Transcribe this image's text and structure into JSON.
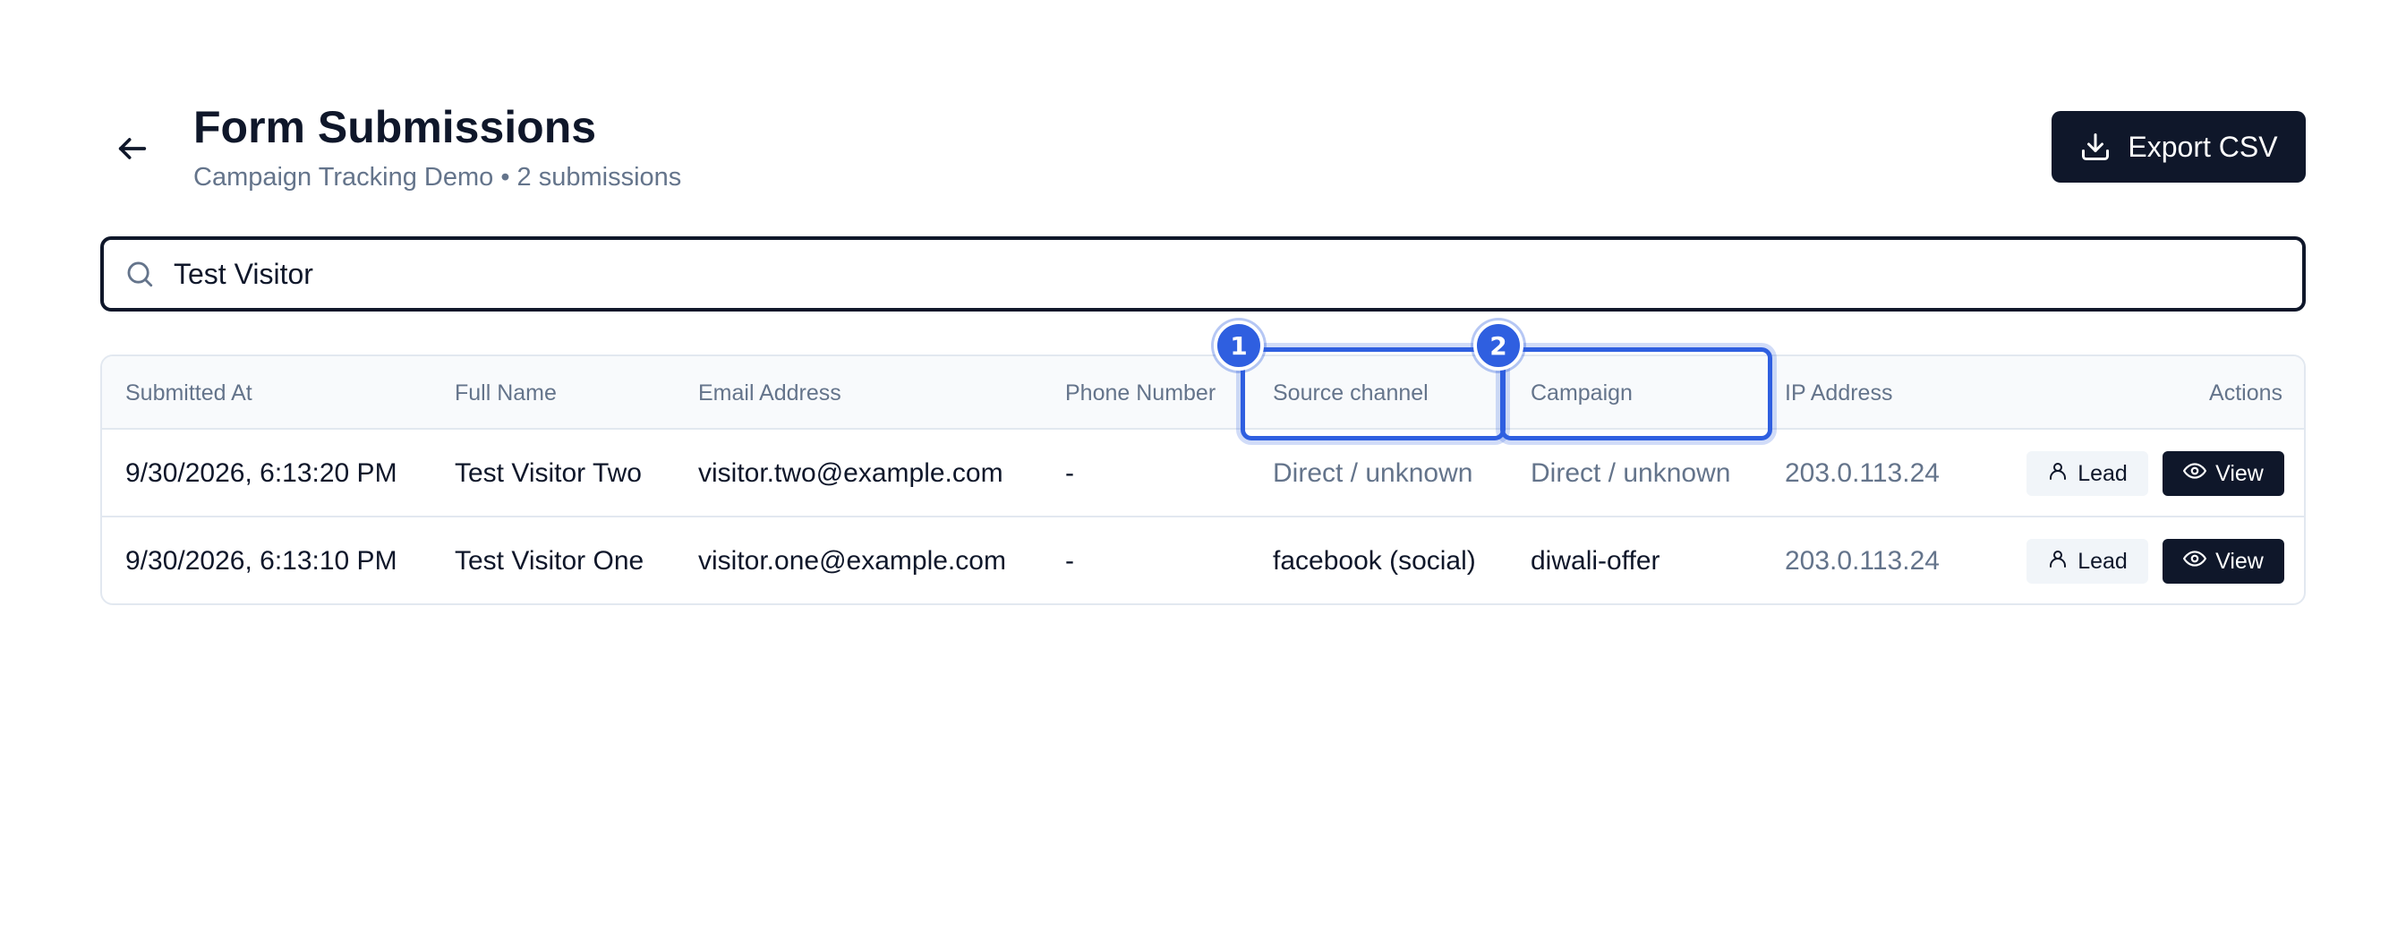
{
  "header": {
    "back_icon": "arrow-left-icon",
    "title": "Form Submissions",
    "subtitle": "Campaign Tracking Demo • 2 submissions",
    "export_label": "Export CSV",
    "export_icon": "download-icon"
  },
  "search": {
    "icon": "search-icon",
    "value": "Test Visitor",
    "placeholder": ""
  },
  "table": {
    "columns": [
      "Submitted At",
      "Full Name",
      "Email Address",
      "Phone Number",
      "Source channel",
      "Campaign",
      "IP Address",
      "Actions"
    ],
    "rows": [
      {
        "submitted_at": "9/30/2026, 6:13:20 PM",
        "full_name": "Test Visitor Two",
        "email": "visitor.two@example.com",
        "phone": "-",
        "source": "Direct / unknown",
        "campaign": "Direct / unknown",
        "ip": "203.0.113.24",
        "lead_label": "Lead",
        "view_label": "View"
      },
      {
        "submitted_at": "9/30/2026, 6:13:10 PM",
        "full_name": "Test Visitor One",
        "email": "visitor.one@example.com",
        "phone": "-",
        "source": "facebook (social)",
        "campaign": "diwali-offer",
        "ip": "203.0.113.24",
        "lead_label": "Lead",
        "view_label": "View"
      }
    ]
  },
  "callouts": {
    "first": "1",
    "second": "2"
  },
  "colors": {
    "primary_dark": "#0f172a",
    "muted_text": "#64748b",
    "header_bg": "#f8fafc",
    "border": "#e2e8f0",
    "highlight": "#2f5fe0"
  }
}
